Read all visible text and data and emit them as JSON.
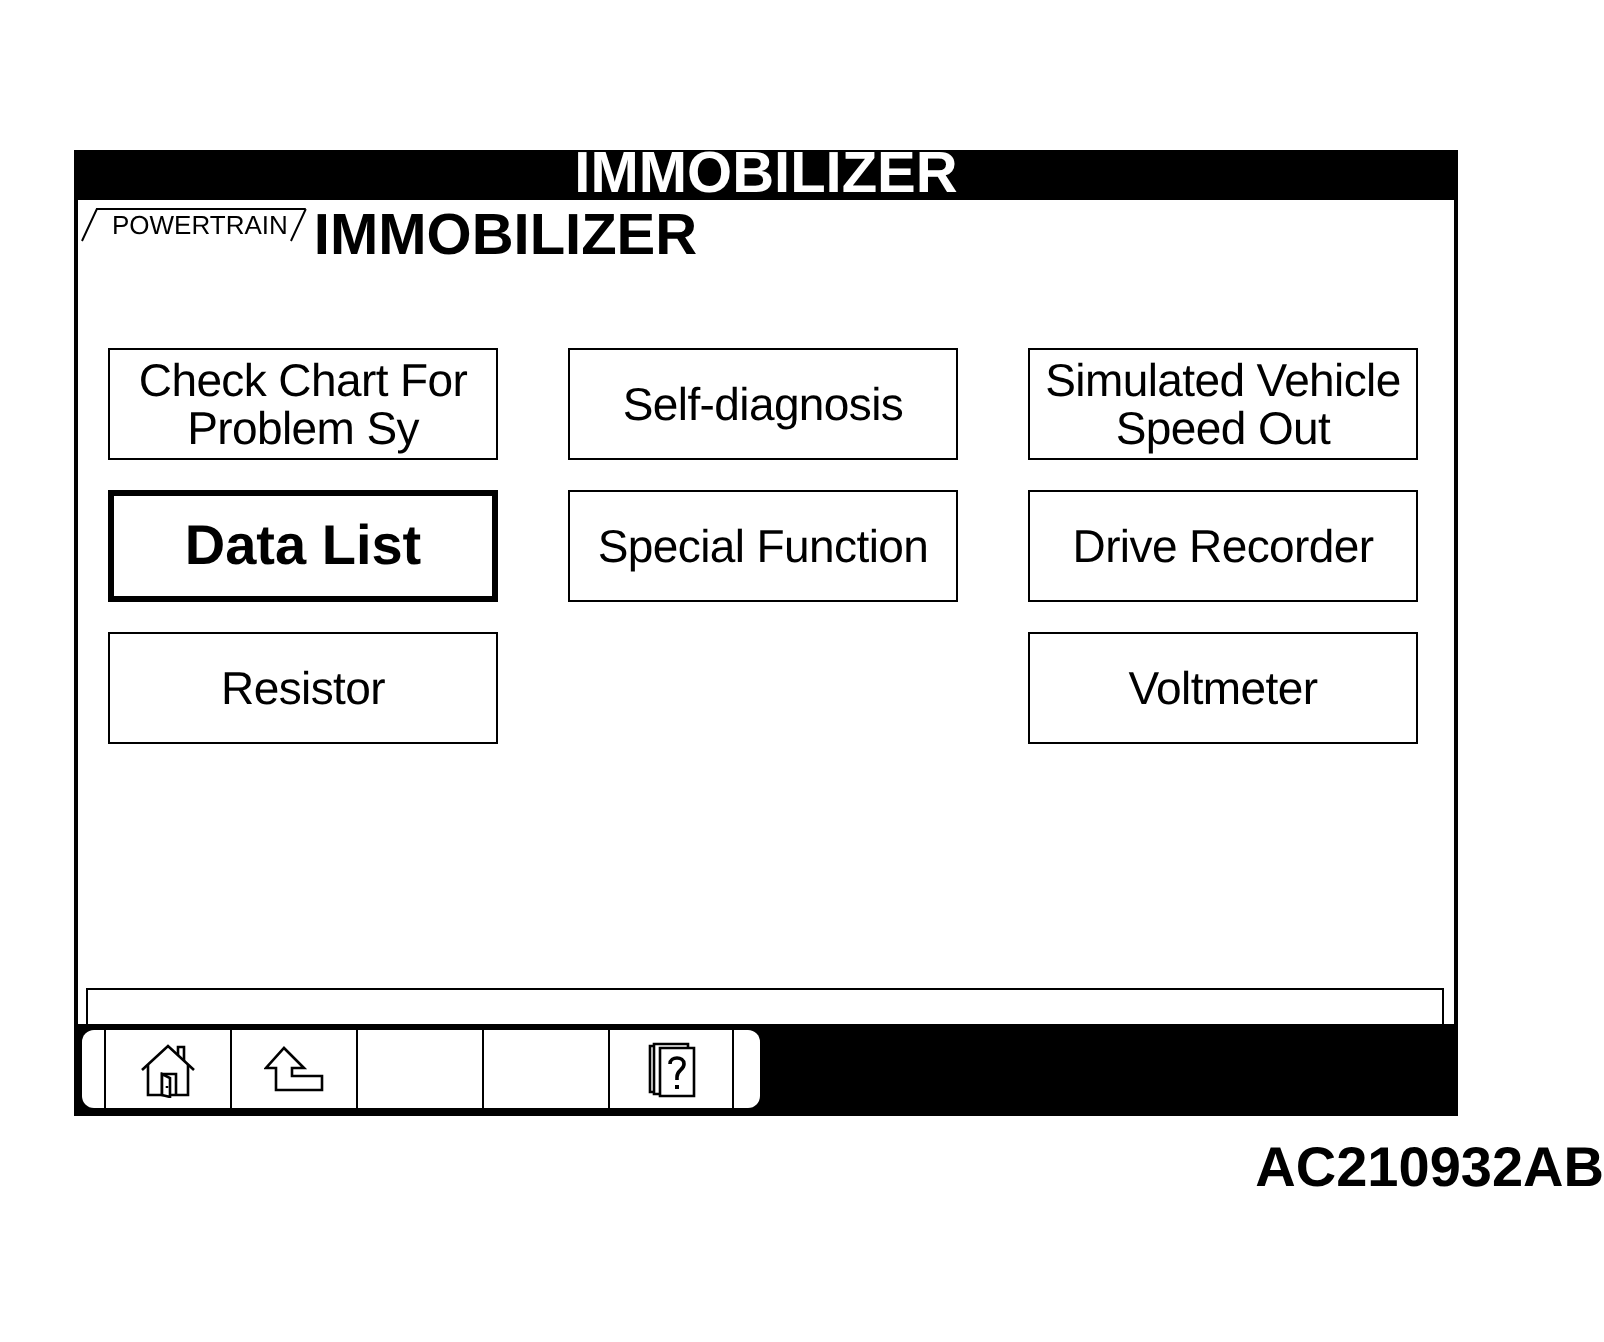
{
  "screen": {
    "title": "IMMOBILIZER"
  },
  "header": {
    "system_tab": "POWERTRAIN",
    "heading": "IMMOBILIZER"
  },
  "menu": {
    "columns": [
      {
        "buttons": [
          {
            "label": "Check Chart For Problem Sy",
            "selected": false
          },
          {
            "label": "Data List",
            "selected": true
          },
          {
            "label": "Resistor",
            "selected": false
          }
        ]
      },
      {
        "buttons": [
          {
            "label": "Self-diagnosis",
            "selected": false
          },
          {
            "label": "Special Function",
            "selected": false
          }
        ]
      },
      {
        "buttons": [
          {
            "label": "Simulated Vehicle Speed Out",
            "selected": false
          },
          {
            "label": "Drive Recorder",
            "selected": false
          },
          {
            "label": "Voltmeter",
            "selected": false
          }
        ]
      }
    ]
  },
  "toolbar": {
    "buttons": [
      {
        "kind": "home"
      },
      {
        "kind": "back"
      },
      {
        "kind": "blank"
      },
      {
        "kind": "blank"
      },
      {
        "kind": "help"
      }
    ]
  },
  "figure_code": "AC210932AB"
}
